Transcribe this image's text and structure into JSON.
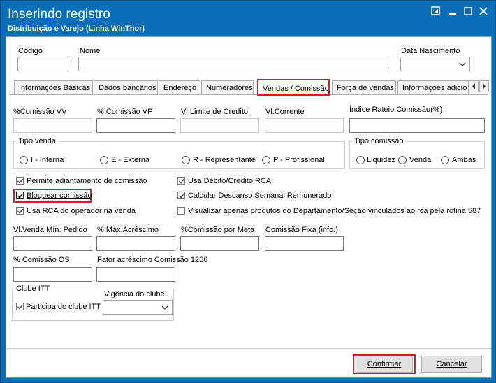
{
  "window": {
    "title": "Inserindo registro",
    "subtitle": "Distribuição e Varejo (Linha WinThor)"
  },
  "header_fields": {
    "codigo_label": "Código",
    "nome_label": "Nome",
    "nascimento_label": "Data Nascimento"
  },
  "tabs": [
    {
      "label": "Informações Básicas"
    },
    {
      "label": "Dados bancários"
    },
    {
      "label": "Endereço"
    },
    {
      "label": "Numeradores"
    },
    {
      "label": "Vendas  / Comissão",
      "active": true
    },
    {
      "label": "Força de vendas"
    },
    {
      "label": "Informações adicio"
    }
  ],
  "row1": {
    "comissao_vv": "%Comissão VV",
    "comissao_vp": "% Comissão VP",
    "limite_credito": "Vl.Limite de Credito",
    "vl_corrente": "Vl.Corrente",
    "indice_rateio": "Índice Rateio Comissão(%)"
  },
  "tipo_venda": {
    "legend": "Tipo venda",
    "options": [
      "I - Interna",
      "E - Externa",
      "R - Representante",
      "P - Profissional"
    ]
  },
  "tipo_comissao": {
    "legend": "Tipo comissão",
    "options": [
      "Liquidez",
      "Venda",
      "Ambas"
    ]
  },
  "checkboxes": {
    "permite_adiantamento": {
      "label": "Permite adiantamento de comissão",
      "checked": true
    },
    "bloquear_comissao": {
      "label": "Bloquear comissão",
      "checked": true
    },
    "usa_rca_operador": {
      "label": "Usa RCA do operador na venda",
      "checked": true
    },
    "usa_debito_credito": {
      "label": "Usa Débito/Crédito RCA",
      "checked": true
    },
    "calcular_descanso": {
      "label": "Calcular Descanso Semanal Remunerado",
      "checked": true
    },
    "visualizar_produtos": {
      "label": "Visualizar apenas produtos do Departamento/Seção vinculados ao rca pela rotina 587",
      "checked": false
    }
  },
  "row2": {
    "venda_min_pedido": "Vl.Venda Mín. Pedido",
    "max_acrescimo": "% Máx.Acréscimo",
    "comissao_meta": "%Comissão por Meta",
    "comissao_fixa": "Comissão Fixa (info.)"
  },
  "row3": {
    "comissao_os": "% Comissão OS",
    "fator_acrescimo": "Fator acréscimo Comissão  1266"
  },
  "clube_itt": {
    "legend": "Clube ITT",
    "participa_label": "Participa do clube ITT",
    "participa_checked": true,
    "vigencia_label": "Vigência do clube"
  },
  "buttons": {
    "confirmar": "Confirmar",
    "cancelar": "Cancelar"
  },
  "colors": {
    "titlebar": "#0a6fb6",
    "highlight": "#d51d25"
  }
}
